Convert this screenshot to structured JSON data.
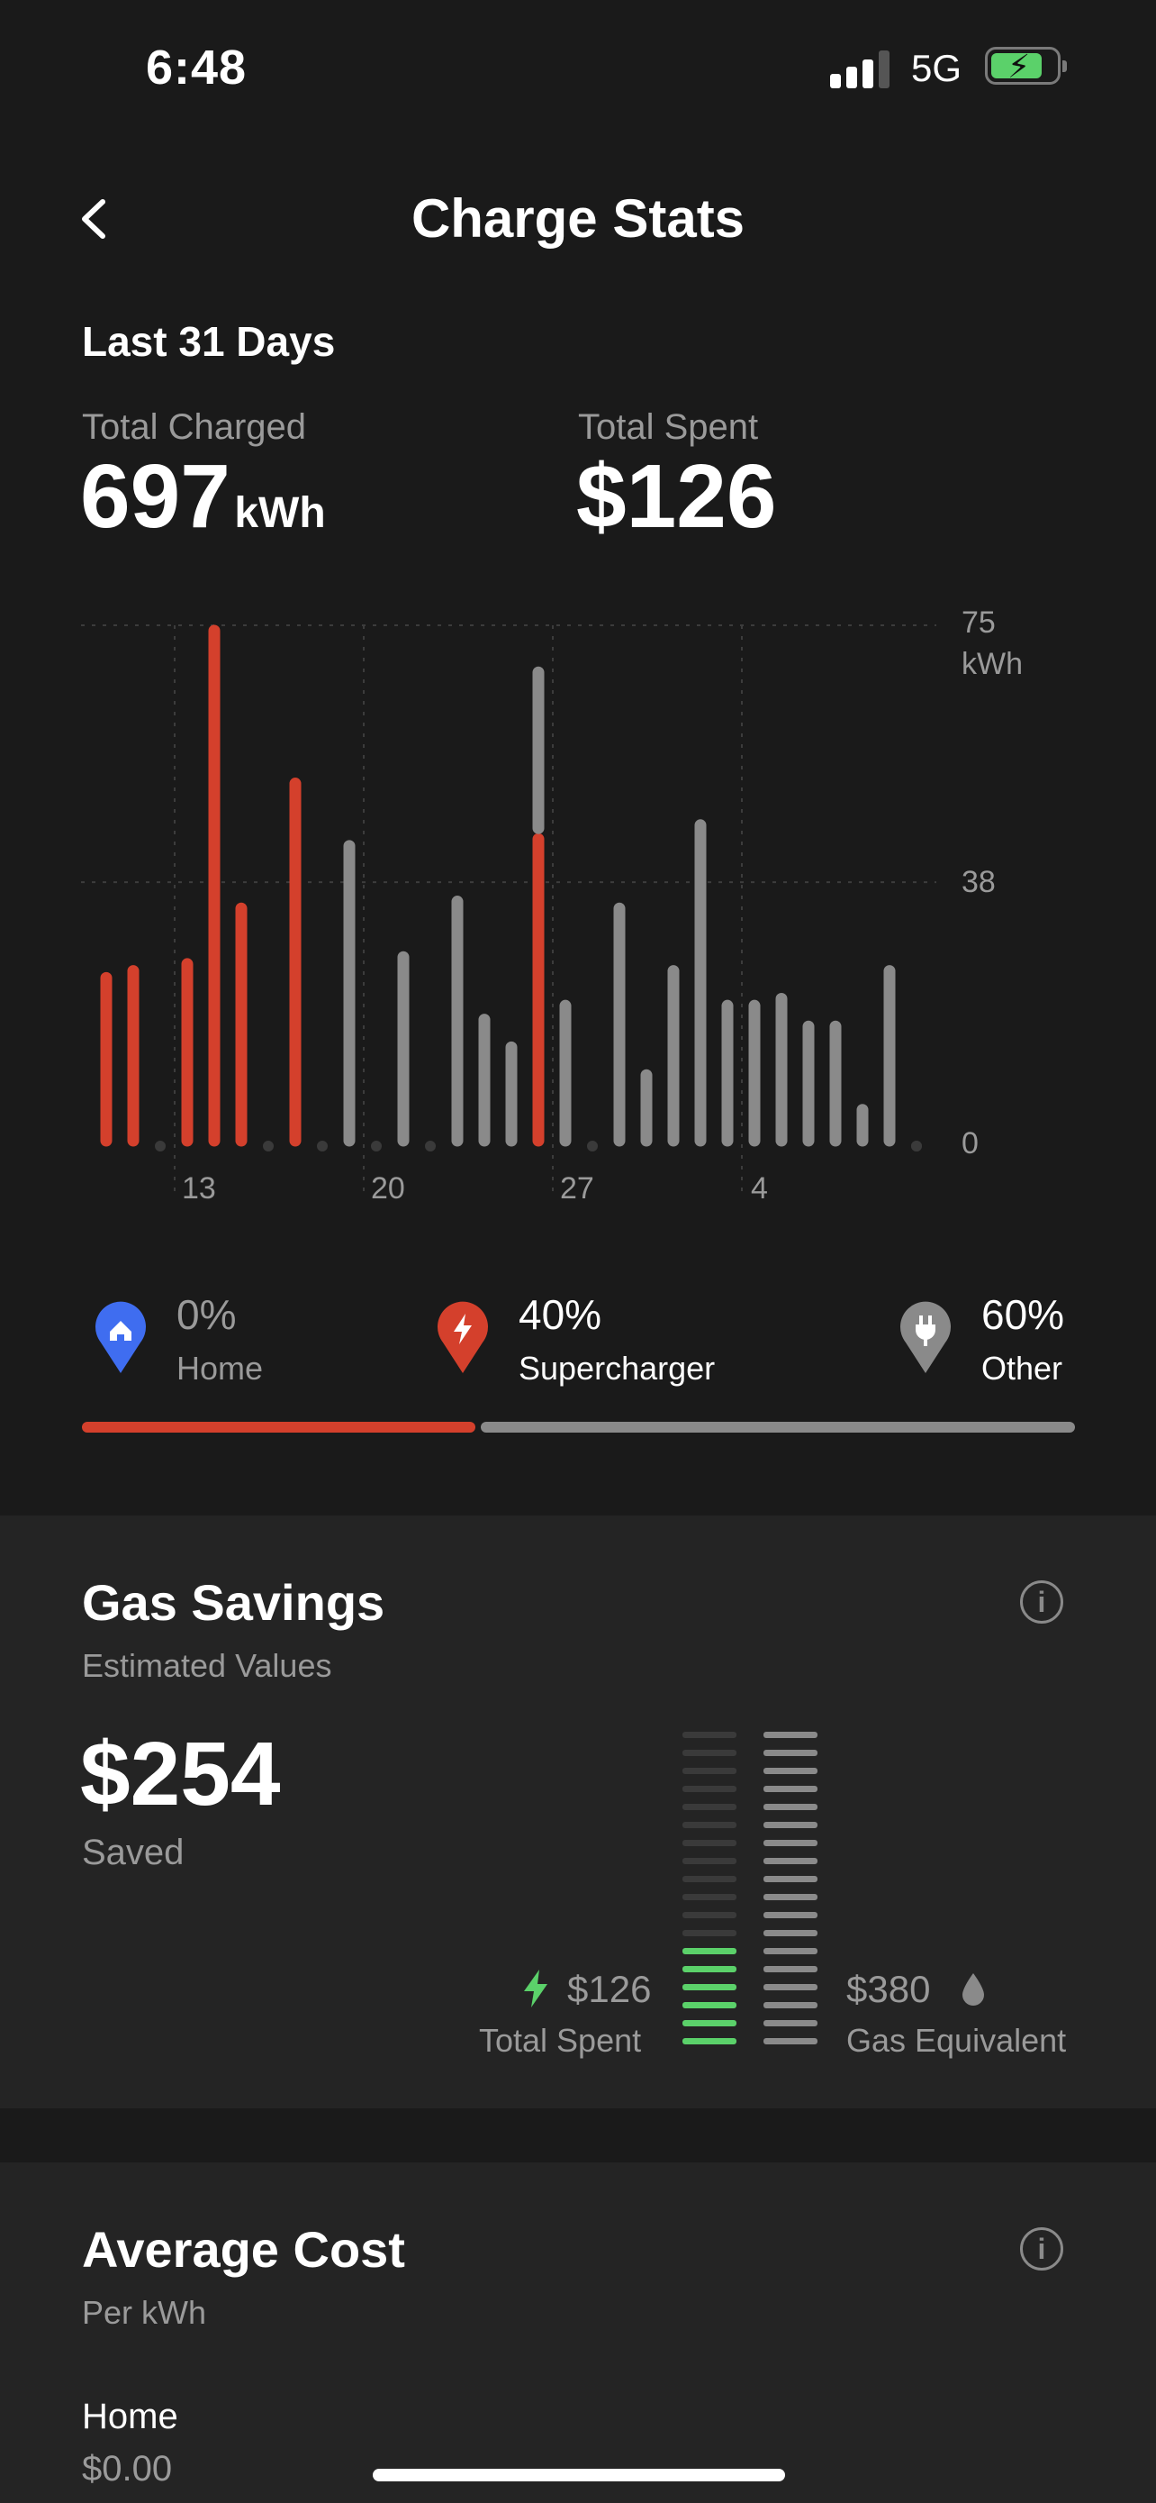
{
  "status_bar": {
    "time": "6:48",
    "network": "5G"
  },
  "header": {
    "title": "Charge Stats"
  },
  "period_label": "Last 31 Days",
  "totals": {
    "charged_label": "Total Charged",
    "charged_value": "697",
    "charged_unit": "kWh",
    "spent_label": "Total Spent",
    "spent_value": "$126"
  },
  "chart_data": {
    "type": "bar",
    "y_unit": "kWh",
    "y_ticks": [
      "75",
      "38",
      "0"
    ],
    "ylim": [
      0,
      75
    ],
    "x_ticks": [
      "13",
      "20",
      "27",
      "4"
    ],
    "colors": {
      "supercharger": "#d4402c",
      "other": "#8a8a8a"
    },
    "days": [
      {
        "supercharger": 25,
        "other": 0
      },
      {
        "supercharger": 26,
        "other": 0
      },
      {
        "supercharger": 0,
        "other": 0
      },
      {
        "supercharger": 27,
        "other": 0
      },
      {
        "supercharger": 75,
        "other": 0
      },
      {
        "supercharger": 35,
        "other": 0
      },
      {
        "supercharger": 0,
        "other": 0
      },
      {
        "supercharger": 53,
        "other": 0
      },
      {
        "supercharger": 0,
        "other": 0
      },
      {
        "supercharger": 0,
        "other": 44
      },
      {
        "supercharger": 0,
        "other": 0
      },
      {
        "supercharger": 0,
        "other": 28
      },
      {
        "supercharger": 0,
        "other": 0
      },
      {
        "supercharger": 0,
        "other": 36
      },
      {
        "supercharger": 0,
        "other": 19
      },
      {
        "supercharger": 0,
        "other": 15
      },
      {
        "supercharger": 45,
        "other": 24
      },
      {
        "supercharger": 0,
        "other": 21
      },
      {
        "supercharger": 0,
        "other": 0
      },
      {
        "supercharger": 0,
        "other": 35
      },
      {
        "supercharger": 0,
        "other": 11
      },
      {
        "supercharger": 0,
        "other": 26
      },
      {
        "supercharger": 0,
        "other": 47
      },
      {
        "supercharger": 0,
        "other": 21
      },
      {
        "supercharger": 0,
        "other": 21
      },
      {
        "supercharger": 0,
        "other": 22
      },
      {
        "supercharger": 0,
        "other": 18
      },
      {
        "supercharger": 0,
        "other": 18
      },
      {
        "supercharger": 0,
        "other": 6
      },
      {
        "supercharger": 0,
        "other": 26
      },
      {
        "supercharger": 0,
        "other": 0
      }
    ]
  },
  "breakdown": [
    {
      "pct": "0%",
      "label": "Home",
      "color": "#3f6df0",
      "icon": "home-icon"
    },
    {
      "pct": "40%",
      "label": "Supercharger",
      "color": "#d4402c",
      "icon": "lightning-icon"
    },
    {
      "pct": "60%",
      "label": "Other",
      "color": "#8a8a8a",
      "icon": "plug-icon"
    }
  ],
  "gas_savings": {
    "title": "Gas Savings",
    "subtitle": "Estimated Values",
    "saved_value": "$254",
    "saved_label": "Saved",
    "spent_value": "$126",
    "spent_label": "Total Spent",
    "gas_value": "$380",
    "gas_label": "Gas Equivalent",
    "spent_fraction": 0.33
  },
  "average_cost": {
    "title": "Average Cost",
    "subtitle": "Per kWh",
    "rows": [
      {
        "label": "Home",
        "value": "$0.00"
      }
    ]
  }
}
